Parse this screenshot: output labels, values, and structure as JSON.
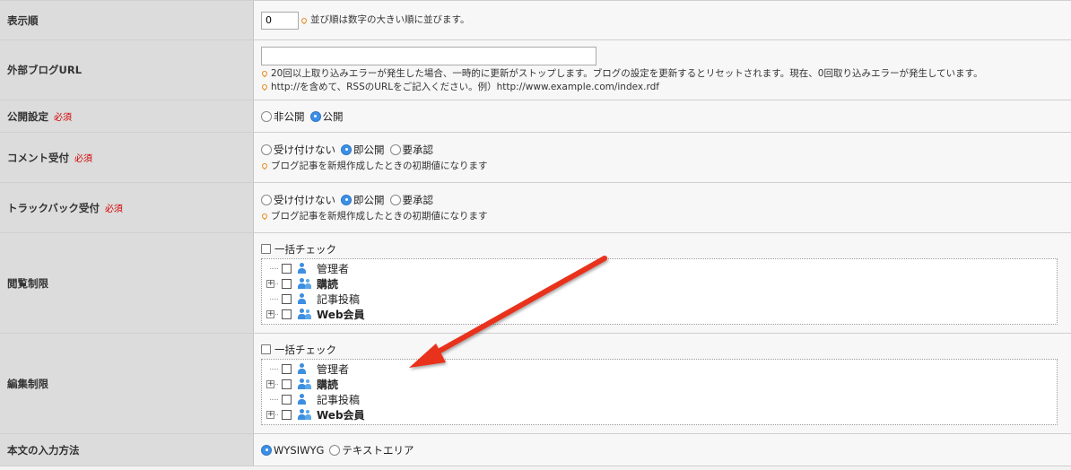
{
  "display_order": {
    "label": "表示順",
    "value": "0",
    "note": "並び順は数字の大きい順に並びます。"
  },
  "external_blog": {
    "label": "外部ブログURL",
    "value": "",
    "note1": "20回以上取り込みエラーが発生した場合、一時的に更新がストップします。ブログの設定を更新するとリセットされます。現在、0回取り込みエラーが発生しています。",
    "note2": "http://を含めて、RSSのURLをご記入ください。例）http://www.example.com/index.rdf"
  },
  "public": {
    "label": "公開設定",
    "required": "必須",
    "options": [
      "非公開",
      "公開"
    ],
    "selected": "公開"
  },
  "comment": {
    "label": "コメント受付",
    "required": "必須",
    "options": [
      "受け付けない",
      "即公開",
      "要承認"
    ],
    "selected": "即公開",
    "note": "ブログ記事を新規作成したときの初期値になります"
  },
  "trackback": {
    "label": "トラックバック受付",
    "required": "必須",
    "options": [
      "受け付けない",
      "即公開",
      "要承認"
    ],
    "selected": "即公開",
    "note": "ブログ記事を新規作成したときの初期値になります"
  },
  "view_limit": {
    "label": "閲覧制限",
    "check_all": "一括チェック",
    "items": [
      {
        "label": "管理者",
        "group": false
      },
      {
        "label": "購読",
        "group": true
      },
      {
        "label": "記事投稿",
        "group": false
      },
      {
        "label": "Web会員",
        "group": true
      }
    ]
  },
  "edit_limit": {
    "label": "編集制限",
    "check_all": "一括チェック",
    "items": [
      {
        "label": "管理者",
        "group": false
      },
      {
        "label": "購読",
        "group": true
      },
      {
        "label": "記事投稿",
        "group": false
      },
      {
        "label": "Web会員",
        "group": true
      }
    ]
  },
  "input_method": {
    "label": "本文の入力方法",
    "options": [
      "WYSIWYG",
      "テキストエリア"
    ],
    "selected": "WYSIWYG"
  },
  "colors": {
    "accent": "#3b8fe6",
    "required": "#d40000",
    "arrow": "#e8321e"
  },
  "icons": [
    "pin-icon",
    "user-icon",
    "group-icon",
    "tree-expand-icon",
    "annotation-arrow-icon"
  ]
}
